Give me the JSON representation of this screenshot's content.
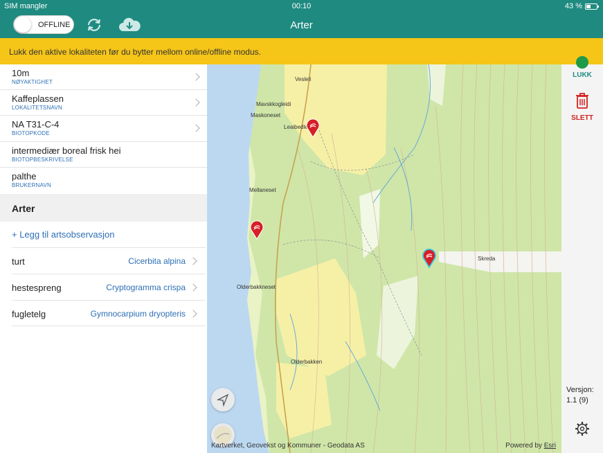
{
  "status_bar": {
    "carrier": "SIM mangler",
    "time": "00:10",
    "battery": "43 %"
  },
  "nav": {
    "toggle_label": "OFFLINE",
    "title": "Arter",
    "sync_icon": "sync-icon",
    "download_icon": "cloud-download-icon",
    "bar_color": "#1e8a80"
  },
  "banner": {
    "text": "Lukk den aktive lokaliteten før du bytter mellom online/offline modus.",
    "color": "#f5c518"
  },
  "details": [
    {
      "value": "10m",
      "label": "NØYAKTIGHET"
    },
    {
      "value": "Kaffeplassen",
      "label": "LOKALITETSNAVN"
    },
    {
      "value": "NA T31-C-4",
      "label": "BIOTOPKODE"
    },
    {
      "value": "intermediær boreal frisk hei",
      "label": "BIOTOPBESKRIVELSE"
    },
    {
      "value": "palthe",
      "label": "BRUKERNAVN"
    }
  ],
  "species_section": {
    "heading": "Arter",
    "add_link": "+ Legg til artsobservasjon",
    "items": [
      {
        "name": "turt",
        "latin": "Cicerbita alpina"
      },
      {
        "name": "hestespreng",
        "latin": "Cryptogramma crispa"
      },
      {
        "name": "fugletelg",
        "latin": "Gymnocarpium dryopteris"
      }
    ]
  },
  "map": {
    "place_names": [
      "Vesleli",
      "Mavskkogleidi",
      "Maskoneset",
      "Leaibedle",
      "Mellaneset",
      "Skreda",
      "Olderbakkneset",
      "Olderbakken"
    ],
    "attribution": "Kartverket, Geovekst og Kommuner - Geodata AS",
    "powered_by": "Powered by ",
    "esri": "Esri"
  },
  "right_panel": {
    "close_label": "LUKK",
    "delete_label": "SLETT",
    "version_label": "Versjon:",
    "version_value": "1.1 (9)"
  }
}
